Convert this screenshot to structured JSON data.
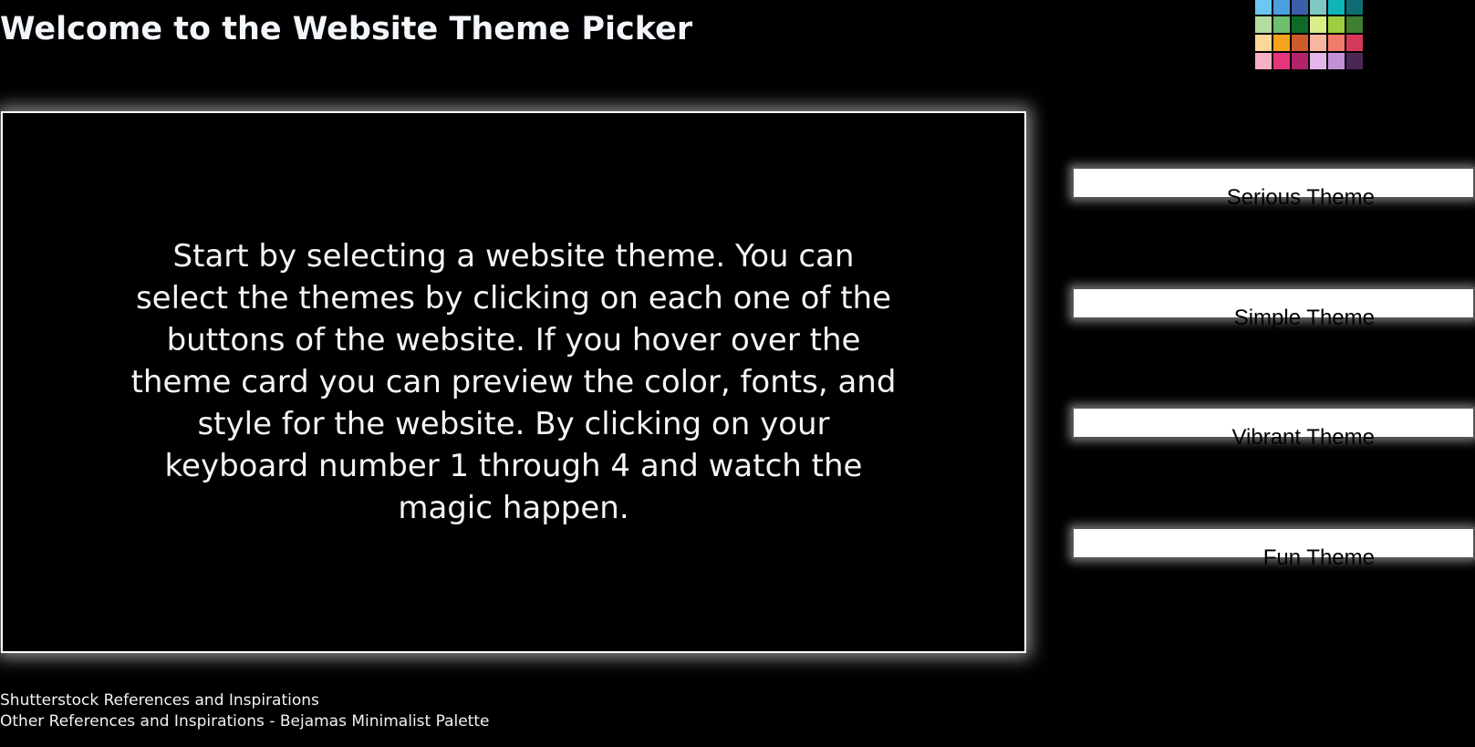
{
  "header": {
    "title": "Welcome to the Website Theme Picker"
  },
  "palette": {
    "colors": [
      "#6cc7f0",
      "#4a9fe0",
      "#3b5fa8",
      "#7fc8c4",
      "#10b5b9",
      "#106c72",
      "#b5dca0",
      "#6dbf6d",
      "#0f6a2a",
      "#d8ef88",
      "#9fcd40",
      "#3f7d30",
      "#fcd79a",
      "#f5a31d",
      "#cc5a2a",
      "#f8b6a0",
      "#f27a6a",
      "#d4395a",
      "#f6b0c4",
      "#e6367b",
      "#b2236a",
      "#e2b6e8",
      "#c290d6",
      "#4b2756"
    ]
  },
  "intro": {
    "text": "Start by selecting a website theme. You can select the themes by clicking on each one of the buttons of the website. If you hover over the theme card you can preview the color, fonts, and style for the website. By clicking on your keyboard number 1 through 4 and watch the magic happen."
  },
  "themes": [
    {
      "label": "Serious Theme"
    },
    {
      "label": "Simple Theme"
    },
    {
      "label": "Vibrant Theme"
    },
    {
      "label": "Fun Theme"
    }
  ],
  "references": {
    "shutterstock_link": "Shutterstock References and Inspirations",
    "other_link": "Other References and Inspirations - Bejamas Minimalist Palette"
  }
}
